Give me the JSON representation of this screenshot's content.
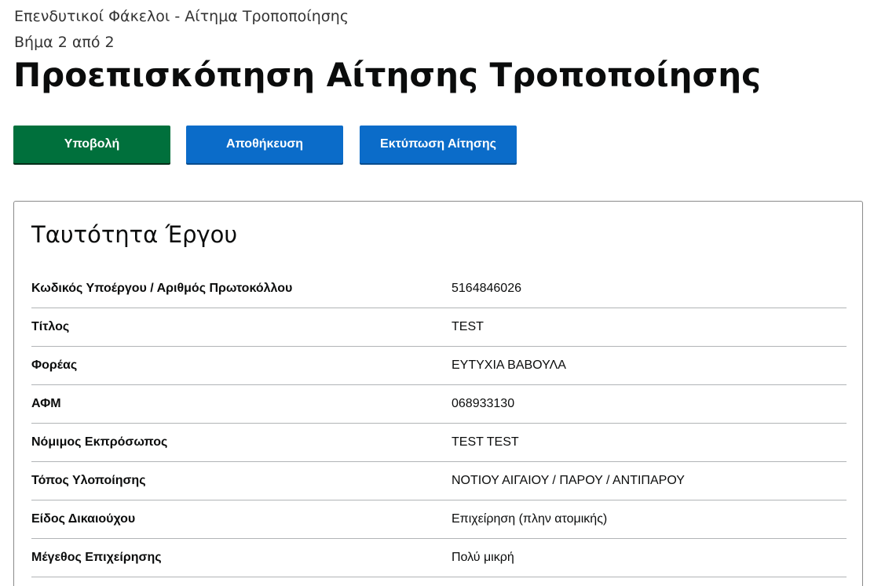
{
  "header": {
    "breadcrumb": "Επενδυτικοί Φάκελοι - Αίτημα Τροποποίησης",
    "step": "Βήμα 2 από 2",
    "title": "Προεπισκόπηση Αίτησης Τροποποίησης"
  },
  "actions": {
    "submit_label": "Υποβολή",
    "save_label": "Αποθήκευση",
    "print_label": "Εκτύπωση Αίτησης"
  },
  "colors": {
    "submit": "#00703c",
    "primary": "#0b6cc9"
  },
  "project_identity": {
    "title": "Ταυτότητα Έργου",
    "rows": [
      {
        "key": "Κωδικός Υποέργου / Αριθμός Πρωτοκόλλου",
        "value": "5164846026"
      },
      {
        "key": "Τίτλος",
        "value": "TEST"
      },
      {
        "key": "Φορέας",
        "value": "ΕΥΤΥΧΙΑ ΒΑΒΟΥΛΑ"
      },
      {
        "key": "ΑΦΜ",
        "value": "068933130"
      },
      {
        "key": "Νόμιμος Εκπρόσωπος",
        "value": "TEST TEST"
      },
      {
        "key": "Τόπος Υλοποίησης",
        "value": "ΝΟΤΙΟΥ ΑΙΓΑΙΟΥ / ΠΑΡΟΥ / ΑΝΤΙΠΑΡΟΥ"
      },
      {
        "key": "Είδος Δικαιούχου",
        "value": "Επιχείρηση (πλην ατομικής)"
      },
      {
        "key": "Μέγεθος Επιχείρησης",
        "value": "Πολύ μικρή"
      }
    ]
  }
}
